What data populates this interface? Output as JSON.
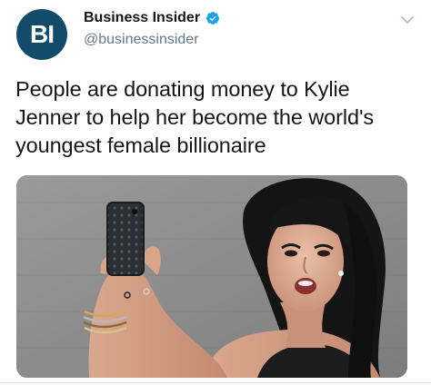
{
  "tweet": {
    "author": {
      "avatar_text": "BI",
      "display_name": "Business Insider",
      "handle": "@businessinsider",
      "verified": true
    },
    "text": "People are donating money to Kylie Jenner to help her become the world's youngest female billionaire",
    "media": {
      "type": "photo",
      "subject": "woman-taking-selfie-with-phone"
    }
  },
  "colors": {
    "avatar_bg": "#134c6a",
    "verified_blue": "#1da1f2",
    "handle_gray": "#657786",
    "text": "#14171a"
  },
  "icons": {
    "verified": "verified-badge-icon",
    "menu": "chevron-down-icon"
  }
}
